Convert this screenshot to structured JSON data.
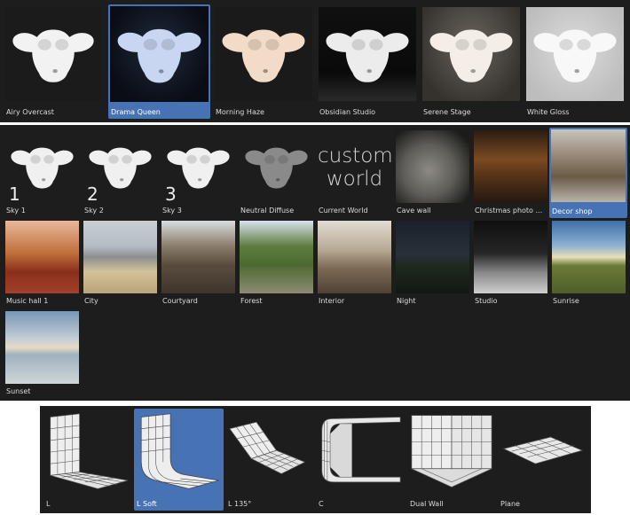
{
  "studio_presets": {
    "items": [
      {
        "label": "Airy Overcast",
        "selected": false
      },
      {
        "label": "Drama Queen",
        "selected": true
      },
      {
        "label": "Morning Haze",
        "selected": false
      },
      {
        "label": "Obsidian Studio",
        "selected": false
      },
      {
        "label": "Serene Stage",
        "selected": false
      },
      {
        "label": "White Gloss",
        "selected": false
      }
    ]
  },
  "world_presets": {
    "items": [
      {
        "label": "Sky 1",
        "number": "1"
      },
      {
        "label": "Sky 2",
        "number": "2"
      },
      {
        "label": "Sky 3",
        "number": "3"
      },
      {
        "label": "Neutral Diffuse"
      },
      {
        "label": "Current World",
        "text": "custom world"
      },
      {
        "label": "Cave wall"
      },
      {
        "label": "Christmas photo ..."
      },
      {
        "label": "Decor shop",
        "selected": true
      },
      {
        "label": "Music hall 1"
      },
      {
        "label": "City"
      },
      {
        "label": "Courtyard"
      },
      {
        "label": "Forest"
      },
      {
        "label": "Interior"
      },
      {
        "label": "Night"
      },
      {
        "label": "Studio"
      },
      {
        "label": "Sunrise"
      },
      {
        "label": "Sunset"
      }
    ]
  },
  "backdrop_presets": {
    "items": [
      {
        "label": "L"
      },
      {
        "label": "L Soft",
        "selected": true
      },
      {
        "label": "L 135°"
      },
      {
        "label": "C"
      },
      {
        "label": "Dual Wall"
      },
      {
        "label": "Plane"
      }
    ]
  },
  "colors": {
    "panel_bg": "#1d1d1d",
    "selection_blue": "#4772b3",
    "label_text": "#dcdcdc"
  }
}
